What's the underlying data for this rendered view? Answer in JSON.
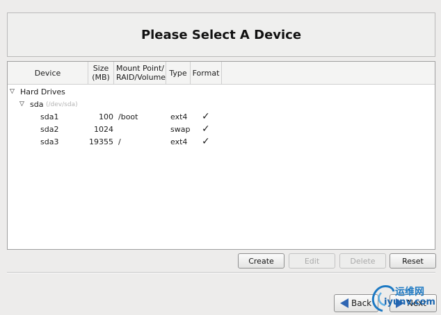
{
  "header": {
    "title": "Please Select A Device"
  },
  "table": {
    "columns": [
      "Device",
      "Size\n(MB)",
      "Mount Point/\nRAID/Volume",
      "Type",
      "Format"
    ],
    "groups": [
      {
        "label": "Hard Drives",
        "disks": [
          {
            "name": "sda",
            "path": "(/dev/sda)",
            "partitions": [
              {
                "device": "sda1",
                "size": "100",
                "mount": "/boot",
                "type": "ext4",
                "format": "✓"
              },
              {
                "device": "sda2",
                "size": "1024",
                "mount": "",
                "type": "swap",
                "format": "✓"
              },
              {
                "device": "sda3",
                "size": "19355",
                "mount": "/",
                "type": "ext4",
                "format": "✓"
              }
            ]
          }
        ]
      }
    ]
  },
  "actions": {
    "create": "Create",
    "edit": "Edit",
    "delete": "Delete",
    "reset": "Reset"
  },
  "nav": {
    "back": "Back",
    "next": "Next"
  },
  "watermark": {
    "cn": "运维网",
    "en": "iyunv.com"
  },
  "icons": {
    "expander": "triangle-down",
    "check": "checkmark",
    "back": "arrow-left",
    "next": "arrow-right"
  },
  "colors": {
    "accent": "#2f66b3"
  }
}
